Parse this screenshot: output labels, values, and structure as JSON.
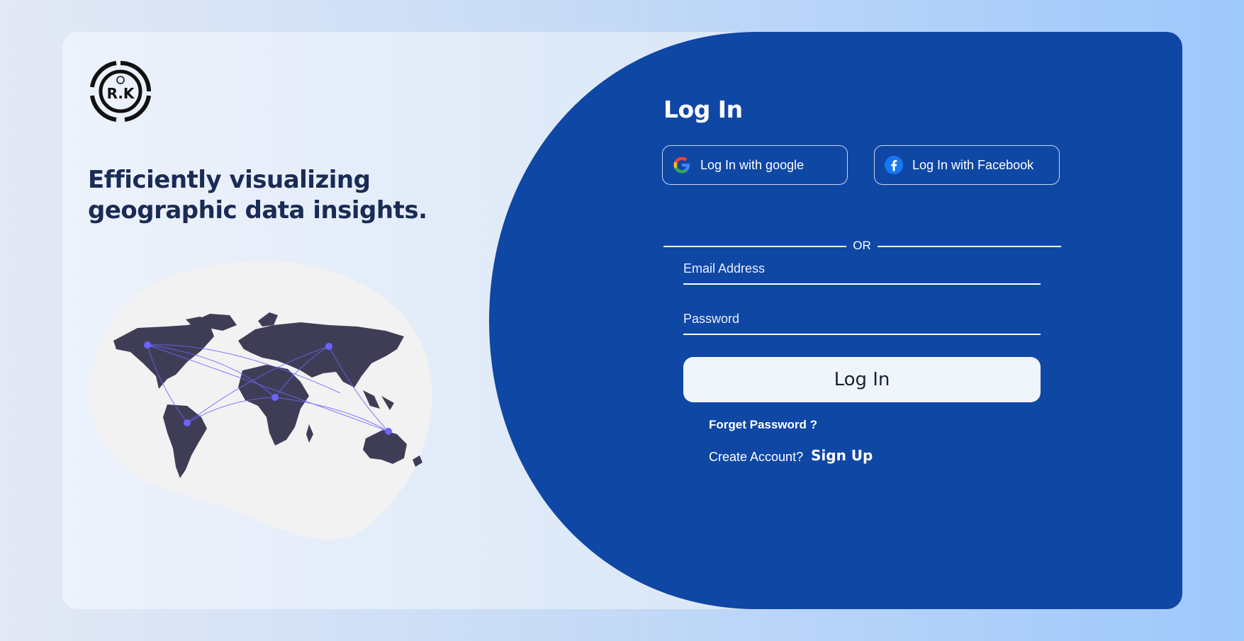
{
  "brand": {
    "logo_text": "R.K"
  },
  "hero": {
    "tagline_line1": "Efficiently visualizing",
    "tagline_line2": "geographic data insights."
  },
  "login": {
    "title": "Log In",
    "google_label": "Log In with google",
    "facebook_label": "Log In with Facebook",
    "divider_text": "OR",
    "email_placeholder": "Email Address",
    "password_placeholder": "Password",
    "submit_label": "Log In",
    "forget_label": "Forget Password ?",
    "create_prompt": "Create Account?",
    "signup_label": "Sign Up"
  },
  "colors": {
    "panel_blue": "#0f47a5",
    "heading_dark": "#1a2b55",
    "map_land": "#3f3d56",
    "map_accent": "#6c63ff",
    "blob": "#f2f2f2"
  },
  "icons": [
    "google-icon",
    "facebook-icon",
    "world-map-illustration",
    "brand-logo"
  ]
}
